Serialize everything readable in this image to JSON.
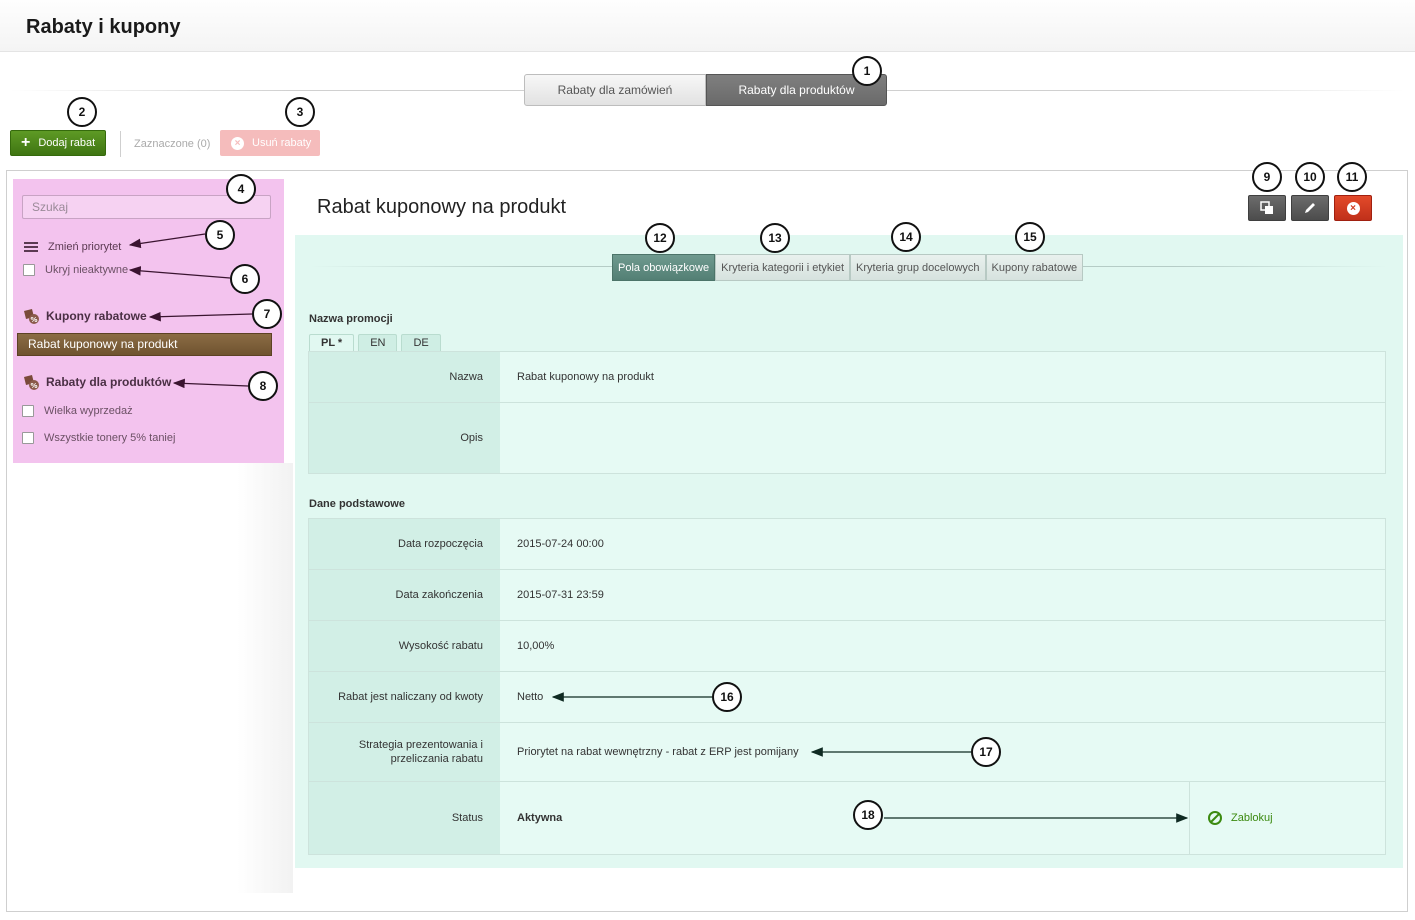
{
  "header": {
    "title": "Rabaty i kupony"
  },
  "top_tabs": [
    {
      "label": "Rabaty dla zamówień",
      "active": false
    },
    {
      "label": "Rabaty dla produktów",
      "active": true
    }
  ],
  "toolbar": {
    "add_label": "Dodaj rabat",
    "selected_label": "Zaznaczone (0)",
    "remove_label": "Usuń rabaty"
  },
  "sidebar": {
    "search_placeholder": "Szukaj",
    "change_priority": "Zmień priorytet",
    "hide_inactive": "Ukryj nieaktywne",
    "coupons_heading": "Kupony rabatowe",
    "coupons_items": [
      "Rabat kuponowy na produkt"
    ],
    "product_heading": "Rabaty dla produktów",
    "product_items": [
      "Wielka wyprzedaż",
      "Wszystkie tonery 5% taniej"
    ]
  },
  "detail": {
    "title": "Rabat kuponowy na produkt",
    "tabs": [
      {
        "label": "Pola obowiązkowe",
        "active": true
      },
      {
        "label": "Kryteria kategorii i etykiet",
        "active": false
      },
      {
        "label": "Kryteria grup docelowych",
        "active": false
      },
      {
        "label": "Kupony rabatowe",
        "active": false
      }
    ],
    "promo_section": "Nazwa promocji",
    "languages": [
      "PL *",
      "EN",
      "DE"
    ],
    "name_label": "Nazwa",
    "name_value": "Rabat kuponowy na produkt",
    "desc_label": "Opis",
    "desc_value": "",
    "basic_section": "Dane podstawowe",
    "start_label": "Data rozpoczęcia",
    "start_value": "2015-07-24 00:00",
    "end_label": "Data zakończenia",
    "end_value": "2015-07-31 23:59",
    "amount_label": "Wysokość rabatu",
    "amount_value": "10,00%",
    "base_label": "Rabat jest naliczany od kwoty",
    "base_value": "Netto",
    "strategy_label": "Strategia prezentowania i przeliczania rabatu",
    "strategy_value": "Priorytet na rabat wewnętrzny - rabat z ERP jest pomijany",
    "status_label": "Status",
    "status_value": "Aktywna",
    "block_label": "Zablokuj"
  },
  "callouts": [
    "1",
    "2",
    "3",
    "4",
    "5",
    "6",
    "7",
    "8",
    "9",
    "10",
    "11",
    "12",
    "13",
    "14",
    "15",
    "16",
    "17",
    "18"
  ],
  "colors": {
    "sidebar_bg": "#f3c3ee",
    "content_bg": "#e1f8f1",
    "add_button": "#4a8218",
    "delete_button": "#d03a20",
    "active_tab": "#6a6a6a",
    "active_detail_tab": "#5f8b80"
  }
}
